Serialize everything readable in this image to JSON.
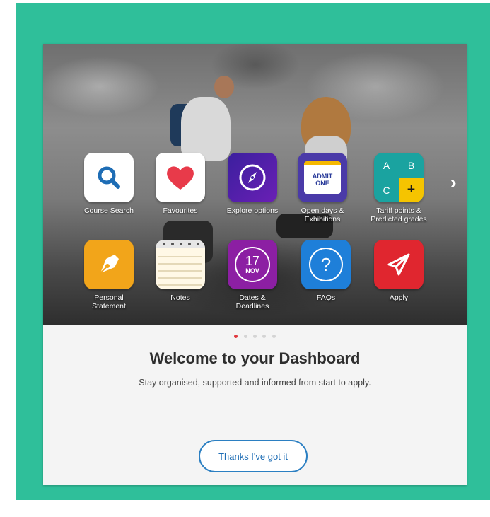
{
  "tiles_row1": [
    {
      "label": "Course Search",
      "icon": "search-icon"
    },
    {
      "label": "Favourites",
      "icon": "heart-icon"
    },
    {
      "label": "Explore options",
      "icon": "compass-icon"
    },
    {
      "label": "Open days &\nExhibitions",
      "icon": "admit-one-ticket-icon",
      "ticket_text": "ADMIT\nONE"
    },
    {
      "label": "Tariff points &\nPredicted grades",
      "icon": "tariff-grid-icon",
      "grid": [
        "A",
        "B",
        "C",
        "+"
      ]
    }
  ],
  "tiles_row2": [
    {
      "label": "Personal\nStatement",
      "icon": "fountain-pen-icon"
    },
    {
      "label": "Notes",
      "icon": "notepad-icon"
    },
    {
      "label": "Dates &\nDeadlines",
      "icon": "calendar-icon",
      "day": "17",
      "month": "NOV"
    },
    {
      "label": "FAQs",
      "icon": "question-icon",
      "symbol": "?"
    },
    {
      "label": "Apply",
      "icon": "paper-plane-icon"
    }
  ],
  "next_arrow": "›",
  "pagination": {
    "total": 5,
    "active": 0
  },
  "welcome": {
    "title": "Welcome to your Dashboard",
    "subtitle": "Stay organised, supported and informed from start to apply."
  },
  "button_label": "Thanks I've got it",
  "colors": {
    "frame": "#2fbf9a",
    "accent_blue": "#1e6db5",
    "active_dot": "#e0393f"
  }
}
